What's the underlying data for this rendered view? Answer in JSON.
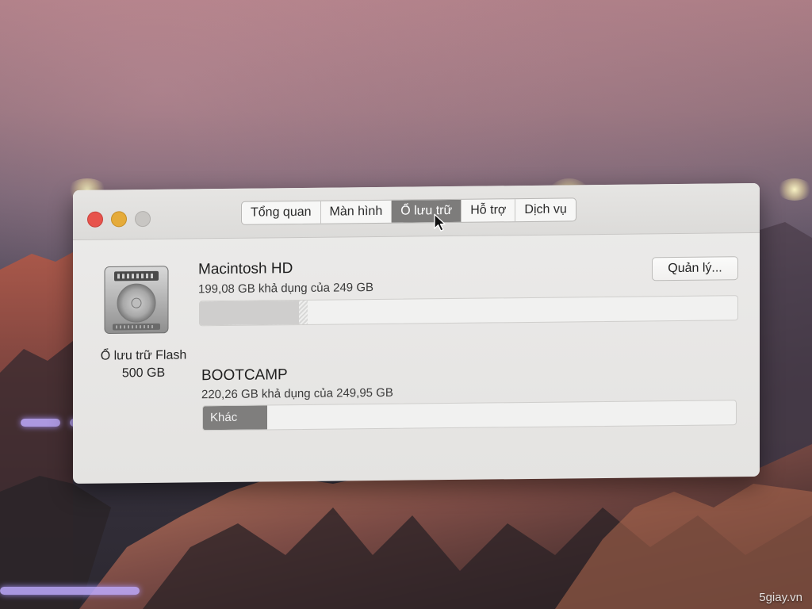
{
  "window": {
    "tabs": [
      {
        "label": "Tổng quan",
        "active": false
      },
      {
        "label": "Màn hình",
        "active": false
      },
      {
        "label": "Ổ lưu trữ",
        "active": true
      },
      {
        "label": "Hỗ trợ",
        "active": false
      },
      {
        "label": "Dịch vụ",
        "active": false
      }
    ]
  },
  "disk": {
    "icon": "hard-drive-icon",
    "type_label": "Ổ lưu trữ Flash",
    "size_label": "500 GB"
  },
  "volumes": [
    {
      "name": "Macintosh HD",
      "availability": "199,08 GB khả dụng của 249 GB",
      "used_fraction": 0.2,
      "segment_label": "",
      "bar_color": "#cfcecd"
    },
    {
      "name": "BOOTCAMP",
      "availability": "220,26 GB khả dụng của 249,95 GB",
      "used_fraction": 0.12,
      "segment_label": "Khác",
      "bar_color": "#7f7e7d"
    }
  ],
  "manage_button": {
    "label": "Quản lý..."
  },
  "watermark": "5giay.vn",
  "colors": {
    "close": "#e7534c",
    "minimize": "#e5ab3a",
    "zoom": "#c8c6c3",
    "tab_active": "#7d7c7b"
  }
}
